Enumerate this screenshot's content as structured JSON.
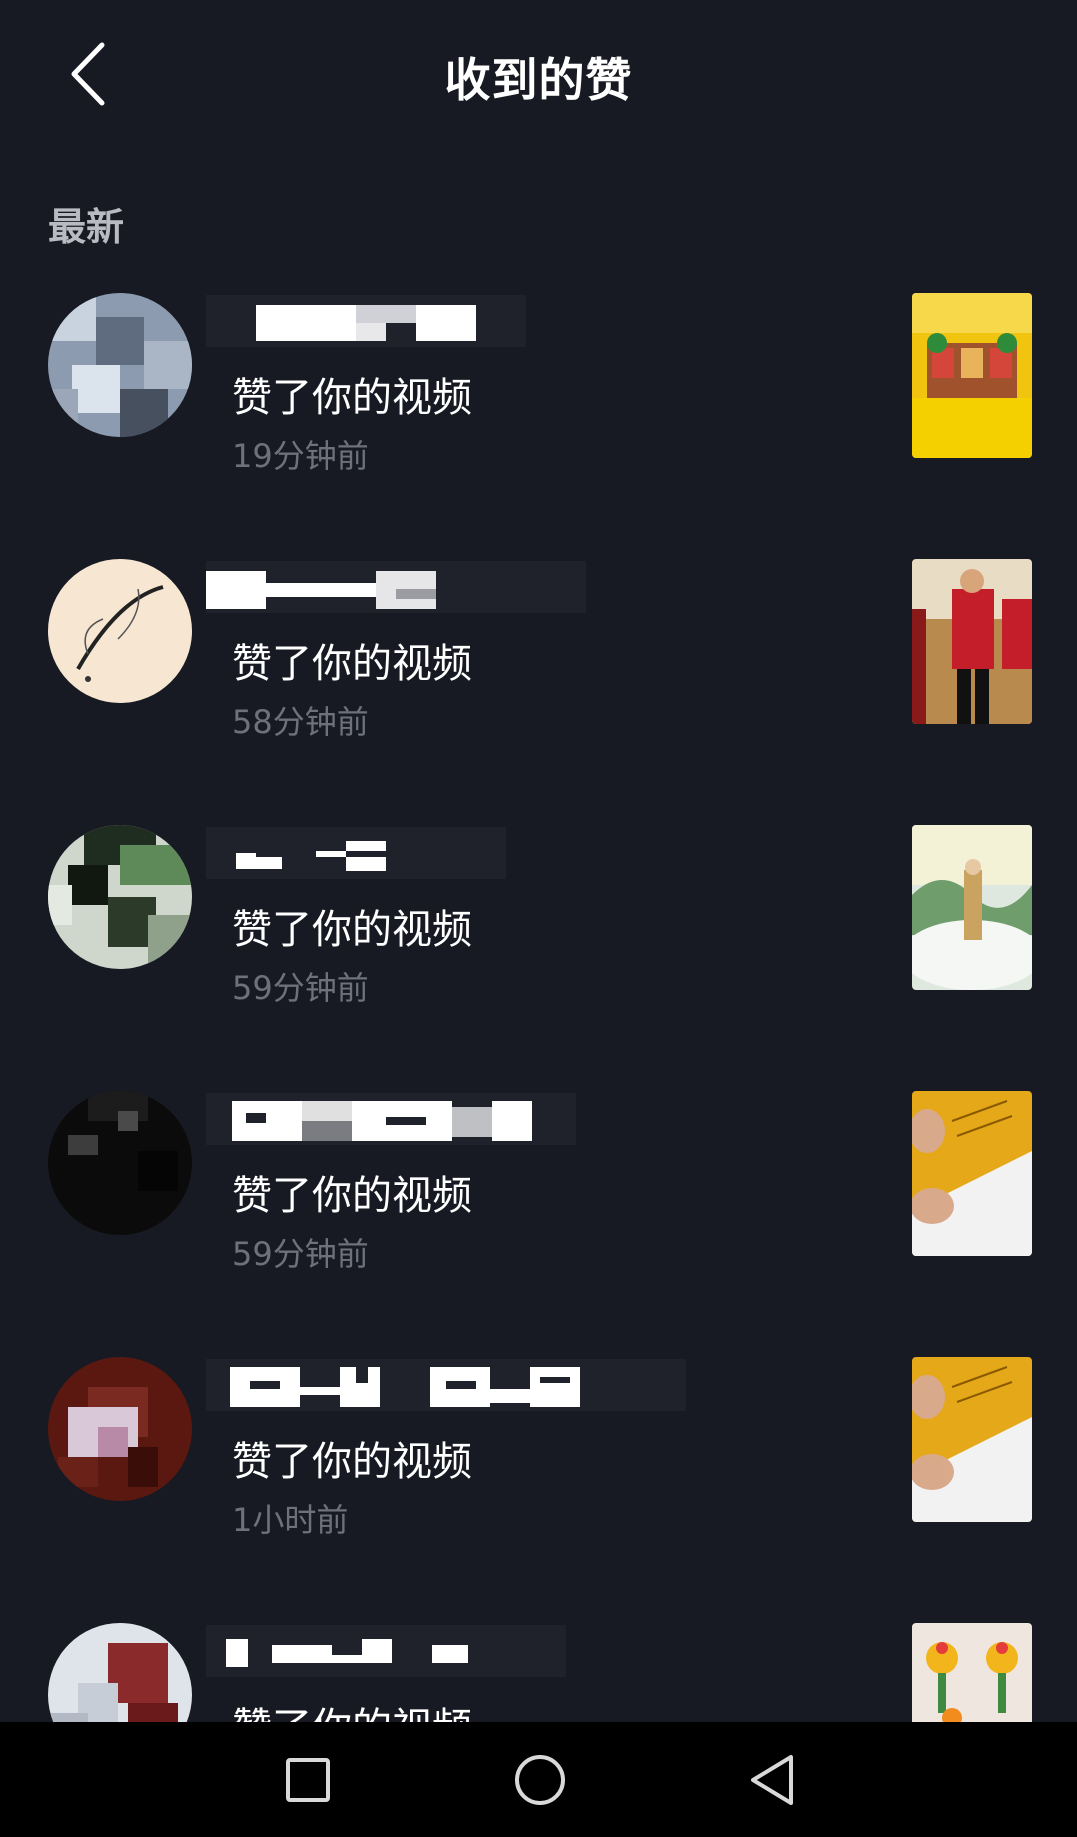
{
  "header": {
    "title": "收到的赞",
    "back_icon": "chevron-left-icon"
  },
  "section": {
    "label": "最新"
  },
  "items": [
    {
      "action": "赞了你的视频",
      "time": "19分钟前"
    },
    {
      "action": "赞了你的视频",
      "time": "58分钟前"
    },
    {
      "action": "赞了你的视频",
      "time": "59分钟前"
    },
    {
      "action": "赞了你的视频",
      "time": "59分钟前"
    },
    {
      "action": "赞了你的视频",
      "time": "1小时前"
    },
    {
      "action": "赞了你的视频",
      "time": ""
    }
  ],
  "navbar": {
    "recent_icon": "square-icon",
    "home_icon": "circle-icon",
    "back_icon": "triangle-back-icon"
  },
  "colors": {
    "background": "#171a22",
    "text_primary": "#ffffff",
    "text_secondary": "#6e717a",
    "section_label": "#b9bbc2",
    "navbar": "#000000"
  }
}
